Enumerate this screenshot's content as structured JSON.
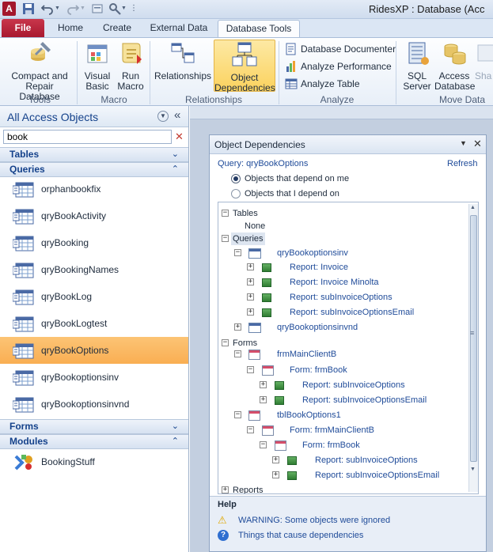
{
  "window": {
    "title": "RidesXP : Database (Acc"
  },
  "tabs": [
    {
      "label": "File"
    },
    {
      "label": "Home"
    },
    {
      "label": "Create"
    },
    {
      "label": "External Data"
    },
    {
      "label": "Database Tools"
    }
  ],
  "ribbon": {
    "tools": {
      "label": "Tools",
      "compact_repair": "Compact and\nRepair Database"
    },
    "macro": {
      "label": "Macro",
      "visual_basic": "Visual\nBasic",
      "run_macro": "Run\nMacro"
    },
    "relationships": {
      "label": "Relationships",
      "relationships": "Relationships",
      "object_dependencies": "Object\nDependencies"
    },
    "analyze": {
      "label": "Analyze",
      "documenter": "Database Documenter",
      "performance": "Analyze Performance",
      "table": "Analyze Table"
    },
    "move_data": {
      "label": "Move Data",
      "sql_server": "SQL\nServer",
      "access_db": "Access\nDatabase",
      "share": "Sha"
    }
  },
  "nav": {
    "header": "All Access Objects",
    "search_value": "book",
    "groups": {
      "tables": "Tables",
      "queries": "Queries",
      "forms": "Forms",
      "modules": "Modules"
    },
    "queries": [
      "orphanbookfix",
      "qryBookActivity",
      "qryBooking",
      "qryBookingNames",
      "qryBookLog",
      "qryBookLogtest",
      "qryBookOptions",
      "qryBookoptionsinv",
      "qryBookoptionsinvnd"
    ],
    "selected_query": "qryBookOptions",
    "modules": [
      "BookingStuff"
    ]
  },
  "deps": {
    "title": "Object Dependencies",
    "query_label": "Query: qryBookOptions",
    "refresh": "Refresh",
    "radio_depend_on_me": "Objects that depend on me",
    "radio_i_depend_on": "Objects that I depend on",
    "tree": {
      "tables": "Tables",
      "none": "None",
      "queries": "Queries",
      "q1": "qryBookoptionsinv",
      "r_invoice": "Report: Invoice",
      "r_invoice_minolta": "Report: Invoice Minolta",
      "r_subinvoiceoptions": "Report: subInvoiceOptions",
      "r_subinvoiceoptionsemail": "Report: subInvoiceOptionsEmail",
      "q2": "qryBookoptionsinvnd",
      "forms": "Forms",
      "f1": "frmMainClientB",
      "f_frmbook": "Form: frmBook",
      "f2": "tblBookOptions1",
      "f_frmmainclientb": "Form: frmMainClientB",
      "reports": "Reports"
    },
    "help": {
      "title": "Help",
      "warning": "WARNING: Some objects were ignored",
      "things": "Things that cause dependencies"
    }
  },
  "colors": {
    "accent_selected": "#f9ae52",
    "file_tab": "#b8243a",
    "link": "#1f4b99",
    "report_icon": "#3f8f3e"
  }
}
